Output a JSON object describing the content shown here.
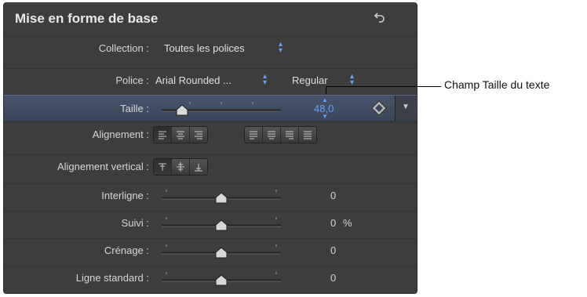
{
  "panel": {
    "title": "Mise en forme de base",
    "reset_icon": "reset-arrow-icon"
  },
  "rows": {
    "collection": {
      "label": "Collection :",
      "value": "Toutes les polices"
    },
    "police": {
      "label": "Police :",
      "font": "Arial Rounded ...",
      "style": "Regular"
    },
    "taille": {
      "label": "Taille :",
      "value": "48,0",
      "slider_level": 0.22
    },
    "alignement": {
      "label": "Alignement :"
    },
    "alignement_vertical": {
      "label": "Alignement vertical :"
    },
    "interligne": {
      "label": "Interligne :",
      "value": "0",
      "slider_level": 0.5
    },
    "suivi": {
      "label": "Suivi :",
      "value": "0",
      "unit": "%",
      "slider_level": 0.5
    },
    "crenage": {
      "label": "Crénage :",
      "value": "0",
      "slider_level": 0.5
    },
    "ligne_standard": {
      "label": "Ligne standard :",
      "value": "0",
      "slider_level": 0.5
    }
  },
  "callout": {
    "text": "Champ Taille du texte"
  },
  "colors": {
    "panel_bg": "#3d3d3d",
    "selected_row": "#45536a",
    "value_blue": "#6aa0ff"
  }
}
